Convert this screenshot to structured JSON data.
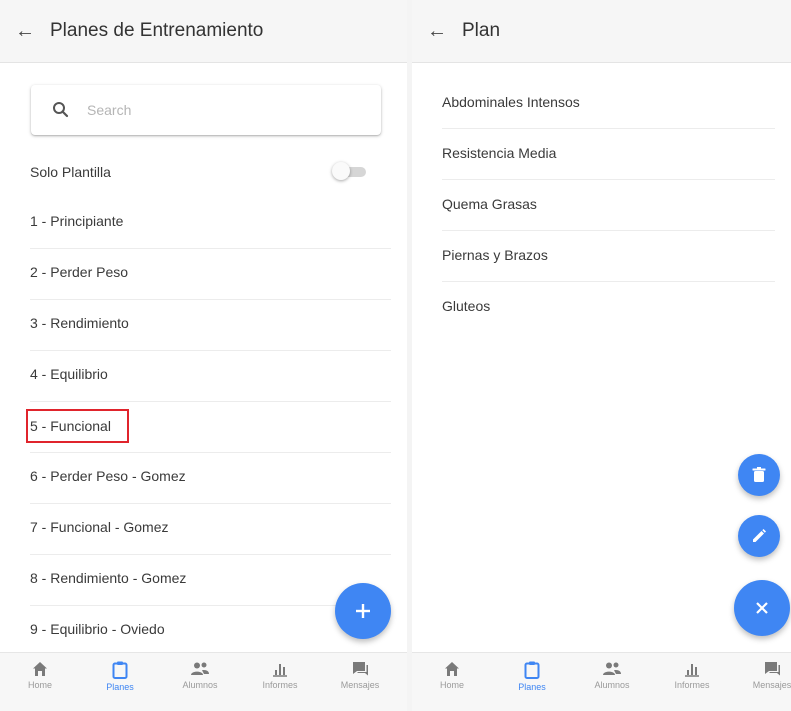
{
  "colors": {
    "accent": "#3f86f3",
    "highlight_box": "#e0242c"
  },
  "left_panel": {
    "title": "Planes de Entrenamiento",
    "search_placeholder": "Search",
    "toggle_label": "Solo Plantilla",
    "toggle_on": false,
    "plans": [
      "1 - Principiante",
      "2 - Perder Peso",
      "3 - Rendimiento",
      "4 - Equilibrio",
      "5 - Funcional",
      "6 - Perder Peso - Gomez",
      "7 - Funcional - Gomez",
      "8 - Rendimiento - Gomez",
      "9 - Equilibrio - Oviedo"
    ],
    "highlighted_plan": "5 - Funcional",
    "fab_icon": "plus-icon"
  },
  "right_panel": {
    "title": "Plan",
    "routines": [
      "Abdominales Intensos",
      "Resistencia Media",
      "Quema Grasas",
      "Piernas y Brazos",
      "Gluteos"
    ],
    "fab_icons": [
      "delete-icon",
      "edit-icon",
      "close-icon"
    ]
  },
  "bottom_nav": {
    "items": [
      {
        "label": "Home",
        "icon": "home-icon"
      },
      {
        "label": "Planes",
        "icon": "clipboard-icon"
      },
      {
        "label": "Alumnos",
        "icon": "people-icon"
      },
      {
        "label": "Informes",
        "icon": "bar-chart-icon"
      },
      {
        "label": "Mensajes",
        "icon": "chat-icon"
      }
    ],
    "active": "Planes"
  }
}
